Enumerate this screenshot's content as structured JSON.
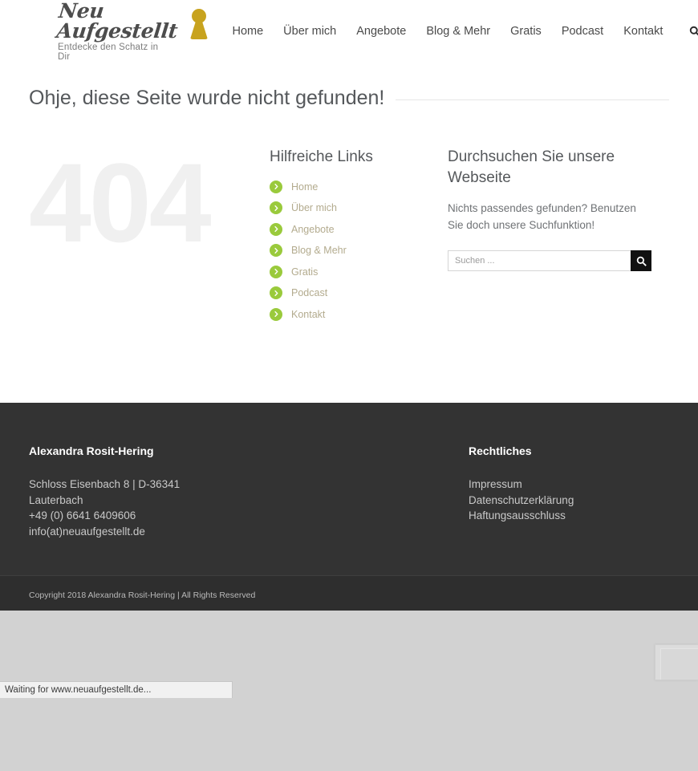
{
  "header": {
    "logo": {
      "name": "Neu Aufgestellt",
      "tagline": "Entdecke den Schatz in Dir",
      "icon": "keyhole-icon",
      "color": "#c8a31e"
    },
    "nav": [
      {
        "label": "Home"
      },
      {
        "label": "Über mich"
      },
      {
        "label": "Angebote"
      },
      {
        "label": "Blog & Mehr"
      },
      {
        "label": "Gratis"
      },
      {
        "label": "Podcast"
      },
      {
        "label": "Kontakt"
      }
    ],
    "search_icon": "search-icon"
  },
  "main": {
    "title": "Ohje, diese Seite wurde nicht gefunden!",
    "error_code": "404",
    "links_section": {
      "heading": "Hilfreiche Links",
      "items": [
        {
          "label": "Home"
        },
        {
          "label": "Über mich"
        },
        {
          "label": "Angebote"
        },
        {
          "label": "Blog & Mehr"
        },
        {
          "label": "Gratis"
        },
        {
          "label": "Podcast"
        },
        {
          "label": "Kontakt"
        }
      ],
      "bullet_color": "#9aca3c",
      "link_color": "#b3ab8e"
    },
    "search_section": {
      "heading": "Durchsuchen Sie unsere Webseite",
      "body": "Nichts passendes gefunden? Benutzen Sie doch unsere Suchfunktion!",
      "input_value": "",
      "input_placeholder": "Suchen ...",
      "button_icon": "search-icon"
    }
  },
  "footer": {
    "contact": {
      "heading": "Alexandra Rosit-Hering",
      "line1": "Schloss Eisenbach 8 | D-36341",
      "line2": "Lauterbach",
      "line3": "+49 (0) 6641 6409606",
      "line4": "info(at)neuaufgestellt.de"
    },
    "legal": {
      "heading": "Rechtliches",
      "items": [
        {
          "label": "Impressum"
        },
        {
          "label": "Datenschutzerklärung"
        },
        {
          "label": "Haftungsausschluss"
        }
      ]
    },
    "copyright": "Copyright 2018 Alexandra Rosit-Hering | All Rights Reserved",
    "background": "#333333"
  },
  "browser": {
    "status_text": "Waiting for www.neuaufgestellt.de..."
  }
}
